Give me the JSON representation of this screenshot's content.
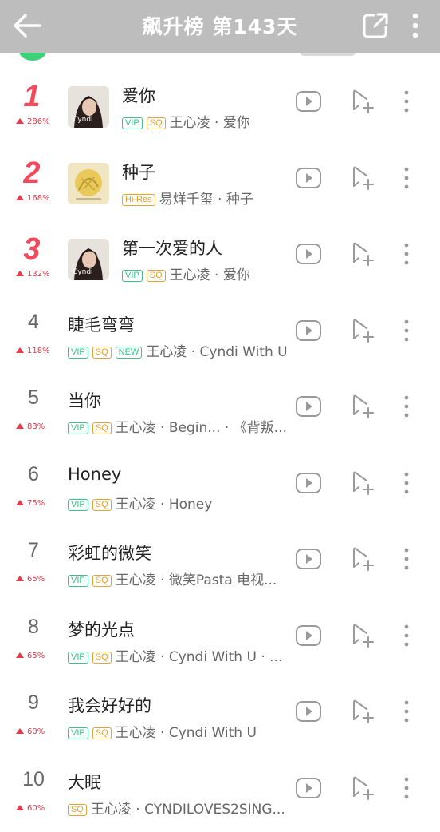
{
  "header": {
    "title": "飙升榜 第143天",
    "bg_color": "#bdbdbd"
  },
  "colors": {
    "rank_top": "#f24a5a",
    "trend": "#e6394a",
    "vip": "#35c489",
    "sq": "#e5a331"
  },
  "songs": [
    {
      "rank": "1",
      "trend": "286%",
      "title": "爱你",
      "tags": [
        "VIP",
        "SQ"
      ],
      "meta": "王心凌 · 爱你",
      "cover": "cyndi"
    },
    {
      "rank": "2",
      "trend": "168%",
      "title": "种子",
      "tags": [
        "Hi-Res"
      ],
      "meta": "易烊千玺 · 种子",
      "cover": "seed"
    },
    {
      "rank": "3",
      "trend": "132%",
      "title": "第一次爱的人",
      "tags": [
        "VIP",
        "SQ"
      ],
      "meta": "王心凌 · 爱你",
      "cover": "cyndi"
    },
    {
      "rank": "4",
      "trend": "118%",
      "title": "睫毛弯弯",
      "tags": [
        "VIP",
        "SQ",
        "NEW"
      ],
      "meta": "王心凌 · Cyndi With U"
    },
    {
      "rank": "5",
      "trend": "83%",
      "title": "当你",
      "tags": [
        "VIP",
        "SQ"
      ],
      "meta": "王心凌 · Begin... · 《背叛..."
    },
    {
      "rank": "6",
      "trend": "75%",
      "title": "Honey",
      "tags": [
        "VIP",
        "SQ"
      ],
      "meta": "王心凌 · Honey"
    },
    {
      "rank": "7",
      "trend": "65%",
      "title": "彩虹的微笑",
      "tags": [
        "VIP",
        "SQ"
      ],
      "meta": "王心凌 · 微笑Pasta 电视..."
    },
    {
      "rank": "8",
      "trend": "65%",
      "title": "梦的光点",
      "tags": [
        "VIP",
        "SQ"
      ],
      "meta": "王心凌 · Cyndi With U · ..."
    },
    {
      "rank": "9",
      "trend": "60%",
      "title": "我会好好的",
      "tags": [
        "VIP",
        "SQ"
      ],
      "meta": "王心凌 · Cyndi With U"
    },
    {
      "rank": "10",
      "trend": "60%",
      "title": "大眠",
      "tags": [
        "SQ"
      ],
      "meta": "王心凌 · CYNDILOVES2SING..."
    }
  ]
}
